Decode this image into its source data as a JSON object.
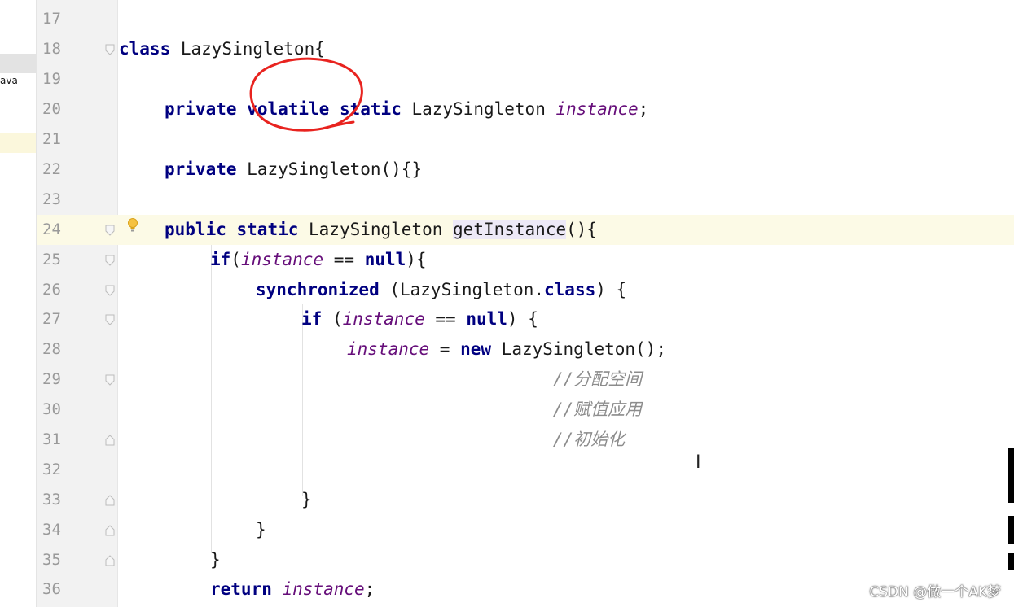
{
  "sidebar": {
    "file_label": "ava"
  },
  "editor": {
    "lines": [
      {
        "n": "17",
        "text": ""
      },
      {
        "n": "18",
        "text": "class LazySingleton{"
      },
      {
        "n": "19",
        "text": ""
      },
      {
        "n": "20",
        "text": "    private volatile static LazySingleton instance;"
      },
      {
        "n": "21",
        "text": ""
      },
      {
        "n": "22",
        "text": "    private LazySingleton(){}"
      },
      {
        "n": "23",
        "text": ""
      },
      {
        "n": "24",
        "text": "    public static LazySingleton getInstance(){"
      },
      {
        "n": "25",
        "text": "        if(instance == null){"
      },
      {
        "n": "26",
        "text": "            synchronized (LazySingleton.class) {"
      },
      {
        "n": "27",
        "text": "                if (instance == null) {"
      },
      {
        "n": "28",
        "text": "                    instance = new LazySingleton();"
      },
      {
        "n": "29",
        "text": "                    //分配空间"
      },
      {
        "n": "30",
        "text": "                    //赋值应用"
      },
      {
        "n": "31",
        "text": "                    //初始化"
      },
      {
        "n": "32",
        "text": ""
      },
      {
        "n": "33",
        "text": "                }"
      },
      {
        "n": "34",
        "text": "            }"
      },
      {
        "n": "35",
        "text": "        }"
      },
      {
        "n": "36",
        "text": "        return instance;"
      }
    ],
    "current_line": "24"
  },
  "icons": {
    "intention": "lightbulb-icon",
    "text_cursor": "text-cursor-icon",
    "annotation": "red-circle-annotation"
  },
  "watermark": "CSDN @做一个AK梦",
  "colors": {
    "keyword": "#000080",
    "field": "#660e7a",
    "comment": "#8c8c8c",
    "annotation": "#e8231f",
    "current_line_bg": "#fcfae6",
    "gutter_bg": "#f2f2f2"
  }
}
